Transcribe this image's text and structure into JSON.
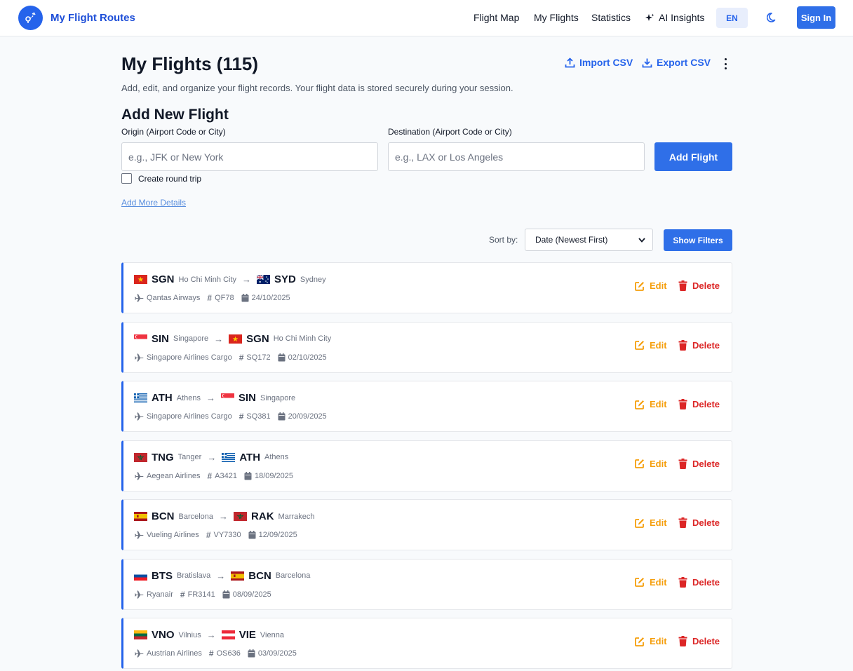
{
  "app": {
    "brand": "My Flight Routes"
  },
  "nav": {
    "links": [
      "Flight Map",
      "My Flights",
      "Statistics",
      "AI Insights"
    ],
    "language": "EN",
    "sign_in": "Sign In"
  },
  "header": {
    "title": "My Flights (115)",
    "subtitle": "Add, edit, and organize your flight records. Your flight data is stored securely during your session.",
    "import_label": "Import CSV",
    "export_label": "Export CSV"
  },
  "add_form": {
    "title": "Add New Flight",
    "origin_label": "Origin (Airport Code or City)",
    "origin_placeholder": "e.g., JFK or New York",
    "destination_label": "Destination (Airport Code or City)",
    "destination_placeholder": "e.g., LAX or Los Angeles",
    "submit_label": "Add Flight",
    "round_trip_label": "Create round trip",
    "more_details_label": "Add More Details"
  },
  "list_controls": {
    "sort_label": "Sort by:",
    "sort_value": "Date (Newest First)",
    "filters_label": "Show Filters"
  },
  "flight_actions": {
    "edit": "Edit",
    "delete": "Delete"
  },
  "colors": {
    "accent": "#2f6fe8",
    "edit": "#f59e0b",
    "delete": "#dc2626"
  },
  "flights": [
    {
      "from_flag": "VN",
      "from_code": "SGN",
      "from_city": "Ho Chi Minh City",
      "to_flag": "AU",
      "to_code": "SYD",
      "to_city": "Sydney",
      "airline": "Qantas Airways",
      "flight_no": "QF78",
      "date": "24/10/2025"
    },
    {
      "from_flag": "SG",
      "from_code": "SIN",
      "from_city": "Singapore",
      "to_flag": "VN",
      "to_code": "SGN",
      "to_city": "Ho Chi Minh City",
      "airline": "Singapore Airlines Cargo",
      "flight_no": "SQ172",
      "date": "02/10/2025"
    },
    {
      "from_flag": "GR",
      "from_code": "ATH",
      "from_city": "Athens",
      "to_flag": "SG",
      "to_code": "SIN",
      "to_city": "Singapore",
      "airline": "Singapore Airlines Cargo",
      "flight_no": "SQ381",
      "date": "20/09/2025"
    },
    {
      "from_flag": "MA",
      "from_code": "TNG",
      "from_city": "Tanger",
      "to_flag": "GR",
      "to_code": "ATH",
      "to_city": "Athens",
      "airline": "Aegean Airlines",
      "flight_no": "A3421",
      "date": "18/09/2025"
    },
    {
      "from_flag": "ES",
      "from_code": "BCN",
      "from_city": "Barcelona",
      "to_flag": "MA",
      "to_code": "RAK",
      "to_city": "Marrakech",
      "airline": "Vueling Airlines",
      "flight_no": "VY7330",
      "date": "12/09/2025"
    },
    {
      "from_flag": "SK",
      "from_code": "BTS",
      "from_city": "Bratislava",
      "to_flag": "ES",
      "to_code": "BCN",
      "to_city": "Barcelona",
      "airline": "Ryanair",
      "flight_no": "FR3141",
      "date": "08/09/2025"
    },
    {
      "from_flag": "LT",
      "from_code": "VNO",
      "from_city": "Vilnius",
      "to_flag": "AT",
      "to_code": "VIE",
      "to_city": "Vienna",
      "airline": "Austrian Airlines",
      "flight_no": "OS636",
      "date": "03/09/2025"
    }
  ]
}
